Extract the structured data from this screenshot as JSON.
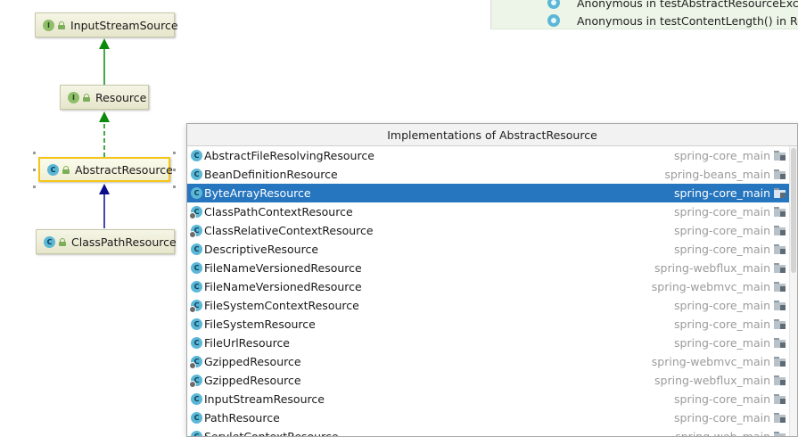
{
  "diagram": {
    "nodes": {
      "input_stream_source": {
        "kind": "I",
        "label": "InputStreamSource"
      },
      "resource": {
        "kind": "I",
        "label": "Resource"
      },
      "abstract_resource": {
        "kind": "C",
        "label": "AbstractResource"
      },
      "class_path_resource": {
        "kind": "C",
        "label": "ClassPathResource"
      }
    },
    "colors": {
      "interface_edge": "#0a8a0a",
      "class_edge": "#0b0b8c",
      "selection": "#f5c518"
    }
  },
  "usages": [
    {
      "icon": "anonymous-class-icon",
      "text": "Anonymous in testAbstractResourceExcept"
    },
    {
      "icon": "anonymous-class-icon",
      "text": "Anonymous in testContentLength() in Resou"
    }
  ],
  "popup": {
    "title": "Implementations of AbstractResource",
    "items": [
      {
        "name": "AbstractFileResolvingResource",
        "module": "spring-core_main",
        "kind": "C",
        "sub": false
      },
      {
        "name": "BeanDefinitionResource",
        "module": "spring-beans_main",
        "kind": "C",
        "sub": false
      },
      {
        "name": "ByteArrayResource",
        "module": "spring-core_main",
        "kind": "C",
        "sub": false,
        "selected": true
      },
      {
        "name": "ClassPathContextResource",
        "module": "spring-core_main",
        "kind": "C",
        "sub": true
      },
      {
        "name": "ClassRelativeContextResource",
        "module": "spring-core_main",
        "kind": "C",
        "sub": true
      },
      {
        "name": "DescriptiveResource",
        "module": "spring-core_main",
        "kind": "C",
        "sub": false
      },
      {
        "name": "FileNameVersionedResource",
        "module": "spring-webflux_main",
        "kind": "C",
        "sub": false
      },
      {
        "name": "FileNameVersionedResource",
        "module": "spring-webmvc_main",
        "kind": "C",
        "sub": false
      },
      {
        "name": "FileSystemContextResource",
        "module": "spring-core_main",
        "kind": "C",
        "sub": true
      },
      {
        "name": "FileSystemResource",
        "module": "spring-core_main",
        "kind": "C",
        "sub": false
      },
      {
        "name": "FileUrlResource",
        "module": "spring-core_main",
        "kind": "C",
        "sub": false
      },
      {
        "name": "GzippedResource",
        "module": "spring-webmvc_main",
        "kind": "C",
        "sub": true
      },
      {
        "name": "GzippedResource",
        "module": "spring-webflux_main",
        "kind": "C",
        "sub": true
      },
      {
        "name": "InputStreamResource",
        "module": "spring-core_main",
        "kind": "C",
        "sub": false
      },
      {
        "name": "PathResource",
        "module": "spring-core_main",
        "kind": "C",
        "sub": false
      },
      {
        "name": "ServletContextResource",
        "module": "spring-web_main",
        "kind": "C",
        "sub": false
      }
    ]
  }
}
